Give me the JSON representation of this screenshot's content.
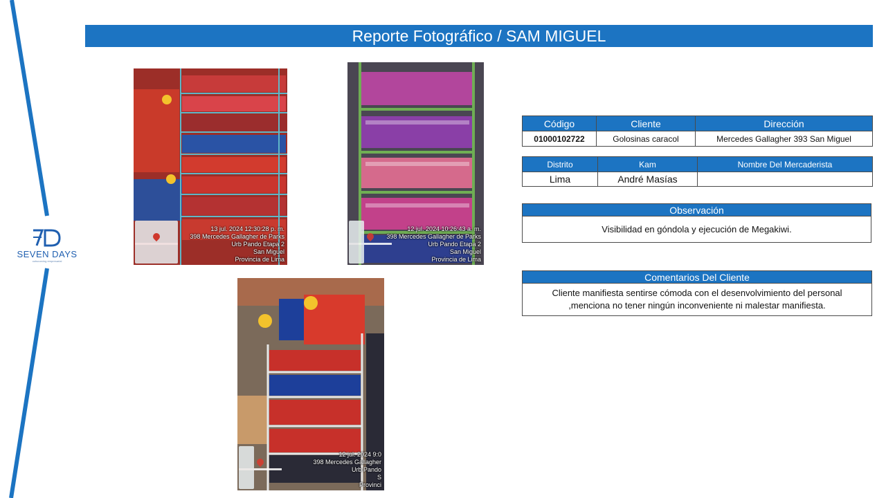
{
  "title": "Reporte Fotográfico / SAM MIGUEL",
  "colors": {
    "accent": "#1c74c2",
    "border": "#4a4a4a"
  },
  "logo": {
    "mark": "7D",
    "name": "SEVEN DAYS",
    "tagline": "outsourcing empresarial"
  },
  "photos": [
    {
      "stamp": [
        "13 jul. 2024 12:30:28 p. m.",
        "398 Mercedes Gallagher de Parks",
        "Urb Pando Etapa 2",
        "San Miguel",
        "Provincia de Lima"
      ]
    },
    {
      "stamp": [
        "12 jul. 2024 10:26:43 a. m.",
        "398 Mercedes Gallagher de Parks",
        "Urb Pando Etapa 2",
        "San Miguel",
        "Provincia de Lima"
      ]
    },
    {
      "stamp": [
        "12 jul. 2024 9:0",
        "398 Mercedes Gallagher",
        "Urb Pando",
        "S",
        "Provinci"
      ]
    }
  ],
  "store_table": {
    "headers": {
      "code": "Código",
      "client": "Cliente",
      "address": "Dirección"
    },
    "values": {
      "code": "01000102722",
      "client": "Golosinas caracol",
      "address": "Mercedes  Gallagher 393 San Miguel"
    }
  },
  "staff_table": {
    "headers": {
      "district": "Distrito",
      "kam": "Kam",
      "merchandiser": "Nombre Del Mercaderista"
    },
    "values": {
      "district": "Lima",
      "kam": "André Masías",
      "merchandiser": ""
    }
  },
  "observation": {
    "header": "Observación",
    "text": "Visibilidad en góndola y ejecución de Megakiwi."
  },
  "client_comments": {
    "header": "Comentarios Del Cliente",
    "line1": "Cliente manifiesta sentirse cómoda con el desenvolvimiento del personal",
    "line2": ",menciona no tener ningún inconveniente ni malestar manifiesta."
  }
}
